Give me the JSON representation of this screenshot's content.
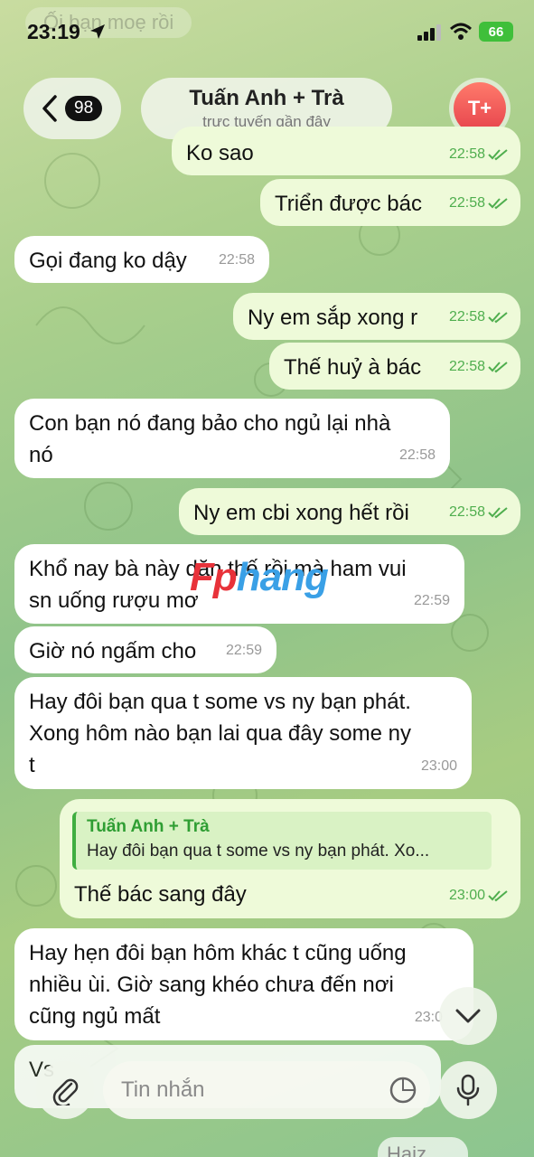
{
  "status_bar": {
    "time": "23:19",
    "battery": "66"
  },
  "header": {
    "back_count": "98",
    "title": "Tuấn Anh + Trà",
    "subtitle": "trực tuyến gần đây",
    "avatar_initials": "T+"
  },
  "ghost_top_text": "Ối bạn moẹ rồi",
  "messages": [
    {
      "dir": "out",
      "text": "Ko sao",
      "time": "22:58"
    },
    {
      "dir": "out",
      "text": "Triển được bác",
      "time": "22:58"
    },
    {
      "dir": "in",
      "text": "Gọi đang ko dậy",
      "time": "22:58"
    },
    {
      "dir": "out",
      "text": "Ny em sắp xong r",
      "time": "22:58"
    },
    {
      "dir": "out",
      "text": "Thế huỷ à bác",
      "time": "22:58"
    },
    {
      "dir": "in",
      "text": "Con bạn nó đang bảo cho ngủ lại nhà nó",
      "line1": "Con bạn nó đang bảo cho ngủ lại nhà",
      "line2": "nó",
      "time": "22:58"
    },
    {
      "dir": "out",
      "text": "Ny em cbi xong hết rồi",
      "time": "22:58"
    },
    {
      "dir": "in",
      "text": "Khổ nay bà này dặn thế rồi mà ham vui sn uống rượu mơ",
      "line1": "Khổ nay bà này dặn thế rồi mà ham vui",
      "line2": "sn uống rượu mơ",
      "time": "22:59"
    },
    {
      "dir": "in",
      "text": "Giờ nó ngấm cho",
      "time": "22:59"
    },
    {
      "dir": "in",
      "text": "Hay đôi bạn qua t some vs ny bạn phát. Xong hôm nào bạn lai qua đây some ny t",
      "line1": "Hay đôi bạn qua t some vs ny bạn phát.",
      "line2": "Xong hôm nào bạn lai qua đây some ny",
      "line3": "t",
      "time": "23:00"
    },
    {
      "dir": "out",
      "text": "Thế bác sang đây",
      "time": "23:00",
      "reply_name": "Tuấn Anh + Trà",
      "reply_text": "Hay đôi bạn qua t some vs ny bạn phát. Xo..."
    },
    {
      "dir": "in",
      "text": "Hay hẹn đôi bạn hôm khác t cũng uống nhiều ùi. Giờ sang khéo chưa đến nơi cũng ngủ mất",
      "line1": "Hay hẹn đôi bạn hôm khác t cũng uống",
      "line2": "nhiều ùi. Giờ sang khéo chưa đến nơi",
      "line3": "cũng ngủ mất",
      "time": "23:0"
    },
    {
      "dir": "in",
      "text": "Vs"
    }
  ],
  "peek_message": "Haiz",
  "watermark": {
    "part1": "Fp",
    "part2": "hang"
  },
  "composer": {
    "placeholder": "Tin nhắn"
  },
  "colors": {
    "outgoing_bubble": "#eefad9",
    "incoming_bubble": "#ffffff",
    "accent_green": "#4fae4e",
    "avatar_red": "#e5414b"
  }
}
